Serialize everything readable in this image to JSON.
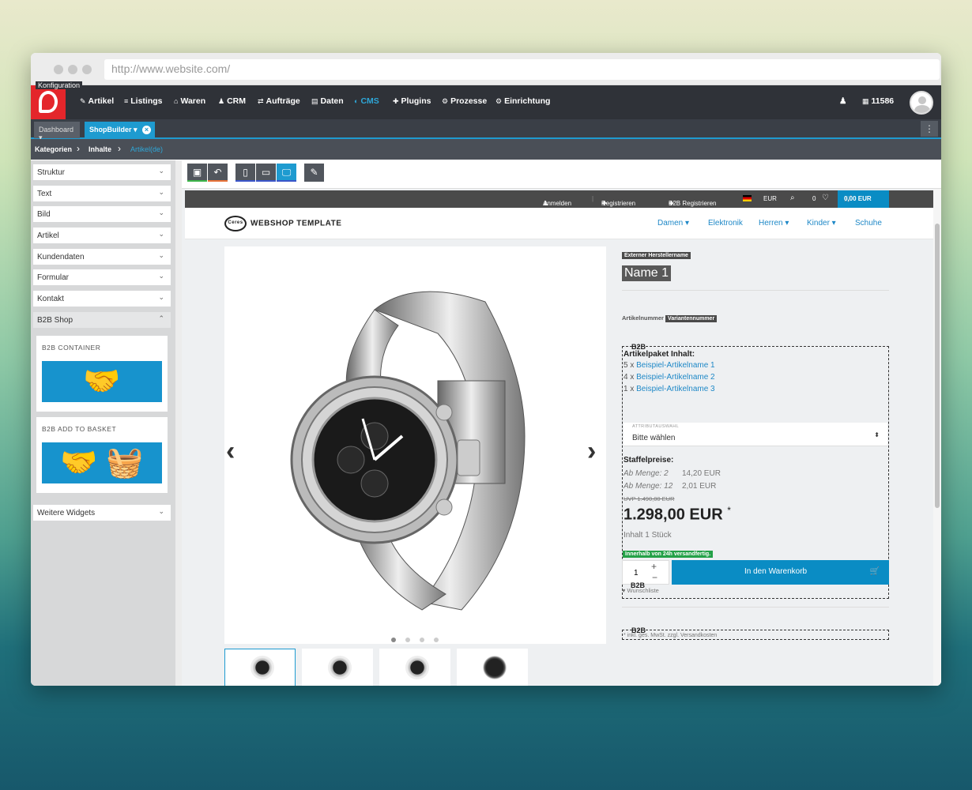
{
  "browser": {
    "url": "http://www.website.com/"
  },
  "topnav": {
    "tooltip": "Konfiguration",
    "items": [
      {
        "icon": "✎",
        "label": "Artikel",
        "active": false
      },
      {
        "icon": "≡",
        "label": "Listings",
        "active": false
      },
      {
        "icon": "⌂",
        "label": "Waren",
        "active": false
      },
      {
        "icon": "♟",
        "label": "CRM",
        "active": false
      },
      {
        "icon": "⇄",
        "label": "Aufträge",
        "active": false
      },
      {
        "icon": "▤",
        "label": "Daten",
        "active": false
      },
      {
        "icon": "◐",
        "label": "CMS",
        "active": true
      },
      {
        "icon": "✚",
        "label": "Plugins",
        "active": false
      },
      {
        "icon": "⚙",
        "label": "Prozesse",
        "active": false
      },
      {
        "icon": "⚙",
        "label": "Einrichtung",
        "active": false
      }
    ],
    "account_id": "11586"
  },
  "tabs": {
    "dashboard": "Dashboard ▾",
    "shopbuilder": "ShopBuilder ▾",
    "more": "⋮"
  },
  "breadcrumb": {
    "item1": "Kategorien",
    "sep": "›",
    "item2": "Inhalte",
    "item3": "Artikel(de)"
  },
  "sidebar": {
    "sections": [
      "Struktur",
      "Text",
      "Bild",
      "Artikel",
      "Kundendaten",
      "Formular",
      "Kontakt",
      "B2B Shop"
    ],
    "widgets": [
      {
        "title": "B2B CONTAINER",
        "icon": "handshake-icon"
      },
      {
        "title": "B2B ADD TO BASKET",
        "icon": "handshake-basket-icon"
      }
    ],
    "more": "Weitere Widgets"
  },
  "shop": {
    "topbar": {
      "login": "Anmelden",
      "register": "Registrieren",
      "b2b_register": "B2B Registrieren",
      "currency": "EUR",
      "wishlist_count": "0",
      "cart": "0,00 EUR"
    },
    "brand": "WEBSHOP TEMPLATE",
    "brand_logo": "Ceres",
    "menu": [
      "Damen ▾",
      "Elektronik",
      "Herren ▾",
      "Kinder ▾",
      "Schuhe"
    ],
    "product": {
      "manufacturer": "Externer Herstellername",
      "name": "Name 1",
      "artnr_label": "Artikelnummer",
      "variant": "Variantennummer",
      "b2b_label": "B2B",
      "set_title": "Artikelpaket Inhalt:",
      "set_items": [
        {
          "qty": "5 x",
          "name": "Beispiel-Artikelname 1"
        },
        {
          "qty": "4 x",
          "name": "Beispiel-Artikelname 2"
        },
        {
          "qty": "1 x",
          "name": "Beispiel-Artikelname 3"
        }
      ],
      "attr_label": "ATTRIBUTAUSWAHL",
      "attr_value": "Bitte wählen",
      "tier_title": "Staffelpreise:",
      "tiers": [
        {
          "label": "Ab Menge: 2",
          "price": "14,20 EUR"
        },
        {
          "label": "Ab Menge: 12",
          "price": "2,01 EUR"
        }
      ],
      "rrp": "UVP 1.490,00 EUR",
      "price": "1.298,00 EUR",
      "price_mark": "*",
      "content": "Inhalt 1 Stück",
      "shipping": "Innerhalb von 24h versandfertig.",
      "qty": "1",
      "add_to_basket": "In den Warenkorb",
      "wishlist": "Wunschliste",
      "vat": "* inkl. ges. MwSt. zzgl. Versandkosten"
    }
  }
}
